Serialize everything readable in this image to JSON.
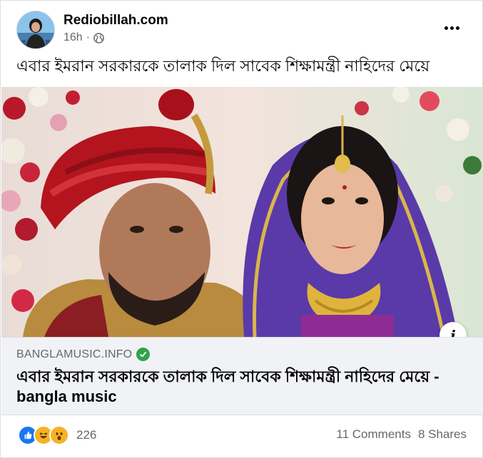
{
  "post": {
    "page_name": "Rediobillah.com",
    "time": "16h",
    "dot": "·",
    "caption": "এবার ইমরান সরকারকে তালাক দিল সাবেক শিক্ষামন্ত্রী নাহিদের মেয়ে"
  },
  "link_preview": {
    "domain": "BANGLAMUSIC.INFO",
    "title": "এবার ইমরান সরকারকে তালাক দিল সাবেক শিক্ষামন্ত্রী নাহিদের মেয়ে - bangla music",
    "info_glyph": "i"
  },
  "footer": {
    "reactions": [
      "like-icon",
      "haha-icon",
      "wow-icon"
    ],
    "reaction_count": "226",
    "comments": "11 Comments",
    "shares": "8 Shares"
  },
  "colors": {
    "like": "#1877f2",
    "emoji": "#f7b125",
    "verified": "#31a24c",
    "link_bg": "#f0f2f5",
    "muted_text": "#65676b"
  }
}
